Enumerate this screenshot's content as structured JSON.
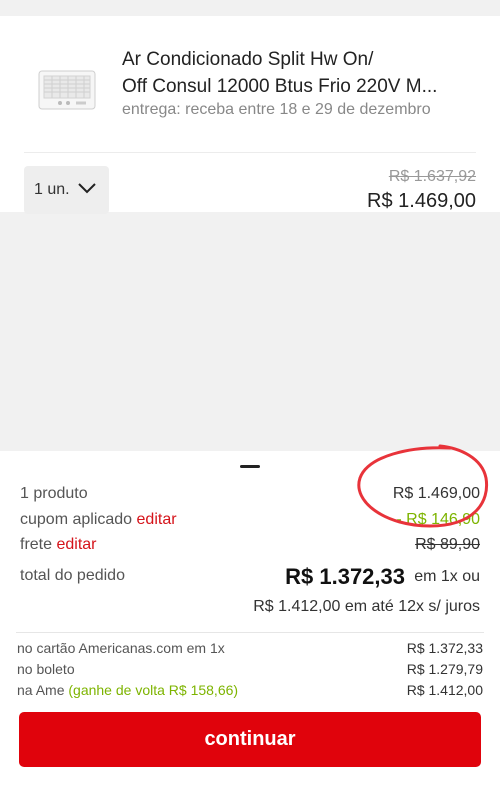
{
  "product": {
    "title_line1": "Ar Condicionado Split Hw On/",
    "title_line2": "Off Consul 12000 Btus Frio 220V M...",
    "delivery": "entrega: receba entre 18 e 29 de dezembro",
    "quantity": "1 un.",
    "old_price": "R$ 1.637,92",
    "price": "R$ 1.469,00",
    "thumbnail_icon": "air-conditioner-icon"
  },
  "summary": {
    "products_label": "1 produto",
    "products_value": "R$ 1.469,00",
    "coupon_label": "cupom aplicado",
    "coupon_edit": "editar",
    "coupon_value": "- R$ 146,90",
    "shipping_label": "frete",
    "shipping_edit": "editar",
    "shipping_value": "R$ 89,90",
    "total_label": "total do pedido",
    "total_value": "R$ 1.372,33",
    "total_suffix": "em 1x ou",
    "installments": "R$ 1.412,00 em até 12x s/ juros"
  },
  "payment": [
    {
      "label": "no cartão Americanas.com em 1x",
      "value": "R$ 1.372,33"
    },
    {
      "label": "no boleto",
      "value": "R$ 1.279,79"
    },
    {
      "label": "na Ame",
      "highlight": "(ganhe de volta R$ 158,66)",
      "value": "R$ 1.412,00"
    }
  ],
  "cta_label": "continuar",
  "colors": {
    "brand_red": "#e0030c",
    "link_red": "#d5131a",
    "discount_green": "#7db400",
    "annotation_red": "#e8333a"
  }
}
